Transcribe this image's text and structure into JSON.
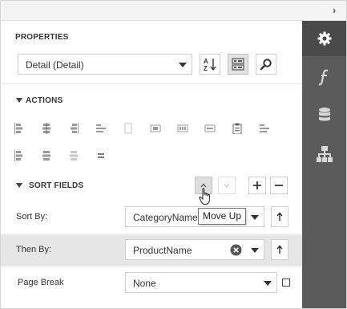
{
  "panel": {
    "collapse_glyph": "›",
    "properties_title": "PROPERTIES",
    "object_selector": {
      "value": "Detail (Detail)"
    },
    "toolbar": {
      "sort_icon": "sort-az-icon",
      "categorized_icon": "categorized-icon",
      "search_icon": "search-icon"
    }
  },
  "sidebar": {
    "items": [
      {
        "icon": "gear-icon",
        "active": true
      },
      {
        "icon": "function-icon",
        "active": false
      },
      {
        "icon": "database-icon",
        "active": false
      },
      {
        "icon": "hierarchy-icon",
        "active": false
      }
    ]
  },
  "actions": {
    "title": "ACTIONS",
    "icons_row1": [
      "align-left-icon",
      "align-center-icon",
      "align-right-icon",
      "align-lines-icon",
      "blank-icon",
      "distribute-h-icon",
      "distribute-v-icon",
      "align-bands-icon",
      "clipboard-icon",
      "align-text-icon"
    ],
    "icons_row2": [
      "align-top-icon",
      "align-middle-icon",
      "align-bottom-icon",
      "align-baseline-icon"
    ]
  },
  "sort_fields": {
    "title": "SORT FIELDS",
    "tooltip": "Move Up",
    "rows": [
      {
        "label": "Sort By:",
        "value": "CategoryName"
      },
      {
        "label": "Then By:",
        "value": "ProductName"
      }
    ]
  },
  "page_break": {
    "label": "Page Break",
    "value": "None"
  },
  "colors": {
    "sidebar_bg": "#5b5b5b",
    "sidebar_active": "#4a4a4a",
    "row_shade": "#e6e6e6"
  }
}
